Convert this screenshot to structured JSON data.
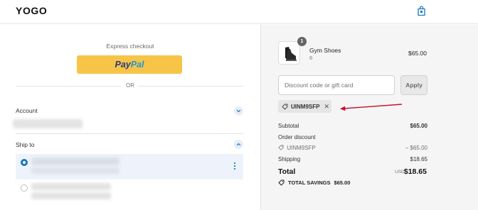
{
  "header": {
    "logo": "YOGO",
    "cart_icon": "shopping-bag-icon"
  },
  "express": {
    "label": "Express checkout",
    "paypal_part1": "Pay",
    "paypal_part2": "Pal",
    "or_label": "OR"
  },
  "account": {
    "label": "Account",
    "chevron_icon": "chevron-down-icon"
  },
  "ship_to": {
    "label": "Ship to",
    "chevron_icon": "chevron-up-icon"
  },
  "order": {
    "product_name": "Gym Shoes",
    "product_variant": "6",
    "product_qty": "1",
    "product_price": "$65.00"
  },
  "discount": {
    "placeholder": "Discount code or gift card",
    "apply_label": "Apply",
    "applied_code": "UINM9SFP",
    "remove_icon": "close-icon",
    "tag_icon": "tag-icon"
  },
  "summary": {
    "subtotal_label": "Subtotal",
    "subtotal_value": "$65.00",
    "order_discount_label": "Order discount",
    "discount_code": "UINM9SFP",
    "discount_value": "− $65.00",
    "shipping_label": "Shipping",
    "shipping_value": "$18.65",
    "total_label": "Total",
    "total_currency": "USD",
    "total_value": "$18.65",
    "savings_label": "TOTAL SAVINGS",
    "savings_value": "$65.00"
  },
  "colors": {
    "paypal_yellow": "#f8c448",
    "accent_blue": "#1878b9",
    "arrow_red": "#c8102e"
  }
}
